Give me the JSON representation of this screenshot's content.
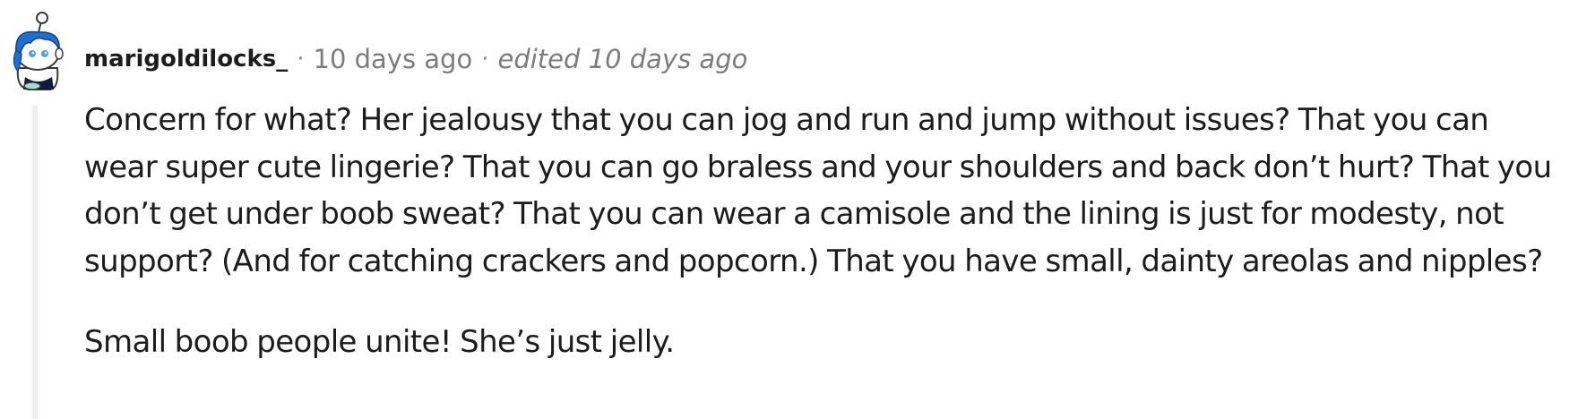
{
  "comment": {
    "author": "marigoldilocks_",
    "separator": "·",
    "timestamp": "10 days ago",
    "edited_label": "edited 10 days ago",
    "avatar_icon": "snoo-avatar-icon",
    "paragraphs": [
      "Concern for what? Her jealousy that you can jog and run and jump without issues? That you can wear super cute lingerie? That you can go braless and your shoulders and back don’t hurt? That you don’t get under boob sweat? That you can wear a camisole and the lining is just for modesty, not support? (And for catching crackers and popcorn.) That you have small, dainty areolas and nipples?",
      "Small boob people unite! She’s just jelly."
    ]
  },
  "colors": {
    "text": "#1c1c1c",
    "meta": "#7c7c7c",
    "thread_line": "#edeff1",
    "avatar_hair": "#1d6fd6"
  }
}
